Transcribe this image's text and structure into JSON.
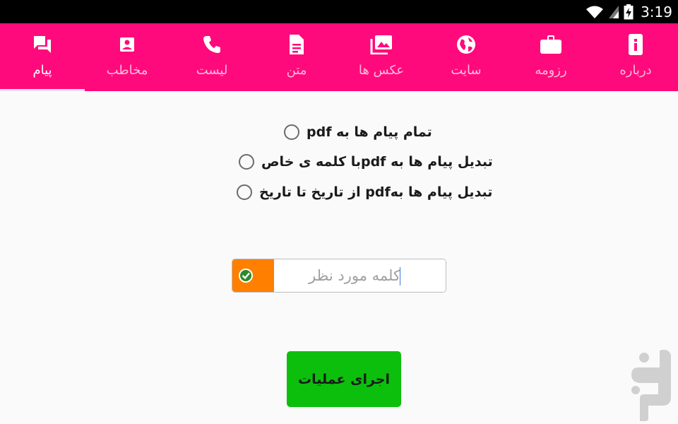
{
  "status_bar": {
    "time": "3:19"
  },
  "tabs": [
    {
      "id": "payam",
      "label": "پیام",
      "icon": "chat-icon",
      "active": true
    },
    {
      "id": "mokhatab",
      "label": "مخاطب",
      "icon": "contact-icon",
      "active": false
    },
    {
      "id": "list",
      "label": "لیست",
      "icon": "phone-icon",
      "active": false
    },
    {
      "id": "matn",
      "label": "متن",
      "icon": "document-icon",
      "active": false
    },
    {
      "id": "aks",
      "label": "عکس ها",
      "icon": "photos-icon",
      "active": false
    },
    {
      "id": "site",
      "label": "سایت",
      "icon": "globe-icon",
      "active": false
    },
    {
      "id": "rezume",
      "label": "رزومه",
      "icon": "briefcase-icon",
      "active": false
    },
    {
      "id": "darbare",
      "label": "درباره",
      "icon": "info-icon",
      "active": false
    }
  ],
  "options": [
    {
      "label": "تمام پیام ها به pdf",
      "selected": false
    },
    {
      "label": "تبدیل پیام ها به pdfبا کلمه ی خاص",
      "selected": false
    },
    {
      "label": "تبدیل پیام ها بهpdf از تاریخ تا تاریخ",
      "selected": false
    }
  ],
  "word_input": {
    "placeholder": "کلمه مورد نظر",
    "value": "",
    "check_icon": "check-circle-icon"
  },
  "run_button": {
    "label": "اجرای عملیات"
  },
  "colors": {
    "accent": "#ff0a7c",
    "input_badge": "#ff7f00",
    "run_button": "#0cbf0c",
    "status_bar": "#000000"
  }
}
